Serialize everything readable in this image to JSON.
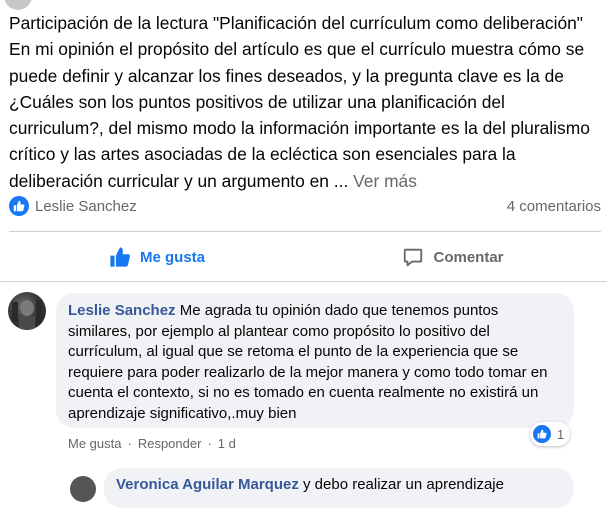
{
  "post": {
    "text": "Participación de la lectura \"Planificación del currículum como deliberación\"\nEn mi opinión el propósito del artículo es que el currículo muestra cómo se puede definir y alcanzar los fines deseados, y la pregunta clave es la de ¿Cuáles son los puntos positivos de utilizar una planificación del curriculum?, del mismo modo la información importante es la del pluralismo crítico y las artes asociadas de la ecléctica son esenciales para la deliberación curricular y un argumento en ... ",
    "see_more": "Ver más"
  },
  "stats": {
    "reactor_name": "Leslie Sanchez",
    "comments_count": "4 comentarios"
  },
  "actions": {
    "like_label": "Me gusta",
    "comment_label": "Comentar"
  },
  "comment": {
    "author": "Leslie Sanchez",
    "text": "Me agrada tu opinión dado que tenemos puntos similares, por ejemplo al plantear como propósito lo positivo del currículum, al igual que se retoma el punto de la experiencia que se requiere para poder realizarlo de la mejor manera y como todo tomar en cuenta el contexto, si no es tomado en cuenta realmente no existirá un aprendizaje significativo,.muy bien",
    "like_link": "Me gusta",
    "reply_link": "Responder",
    "time": "1 d",
    "reaction_count": "1"
  },
  "reply_preview": {
    "author": "Veronica Aguilar Marquez",
    "text": "y debo realizar un aprendizaje"
  },
  "colors": {
    "facebook_blue": "#1877f2",
    "secondary_text": "#65676b",
    "bubble_bg": "#f0f2f5",
    "author_link": "#385898"
  }
}
